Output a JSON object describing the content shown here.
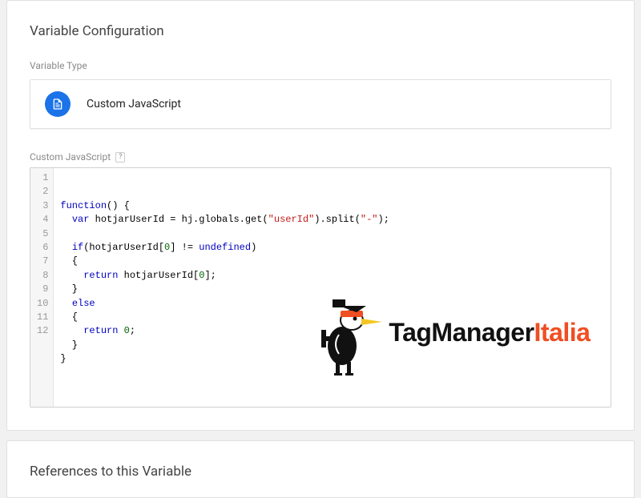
{
  "sections": {
    "config_title": "Variable Configuration",
    "type_label": "Variable Type",
    "variable_type_name": "Custom JavaScript",
    "code_label": "Custom JavaScript",
    "help_symbol": "?",
    "references_title": "References to this Variable"
  },
  "code": {
    "line_count": 12,
    "lines": [
      {
        "n": 1,
        "tokens": [
          {
            "t": "function",
            "c": "blue"
          },
          {
            "t": "() {",
            "c": "black"
          }
        ]
      },
      {
        "n": 2,
        "tokens": [
          {
            "t": "  ",
            "c": "black"
          },
          {
            "t": "var",
            "c": "blue"
          },
          {
            "t": " hotjarUserId = hj.globals.get(",
            "c": "black"
          },
          {
            "t": "\"userId\"",
            "c": "red"
          },
          {
            "t": ").split(",
            "c": "black"
          },
          {
            "t": "\"-\"",
            "c": "red"
          },
          {
            "t": ");",
            "c": "black"
          }
        ]
      },
      {
        "n": 3,
        "tokens": []
      },
      {
        "n": 4,
        "tokens": [
          {
            "t": "  ",
            "c": "black"
          },
          {
            "t": "if",
            "c": "blue"
          },
          {
            "t": "(hotjarUserId[",
            "c": "black"
          },
          {
            "t": "0",
            "c": "num"
          },
          {
            "t": "] != ",
            "c": "black"
          },
          {
            "t": "undefined",
            "c": "blue"
          },
          {
            "t": ")",
            "c": "black"
          }
        ]
      },
      {
        "n": 5,
        "tokens": [
          {
            "t": "  {",
            "c": "black"
          }
        ]
      },
      {
        "n": 6,
        "tokens": [
          {
            "t": "    ",
            "c": "black"
          },
          {
            "t": "return",
            "c": "blue"
          },
          {
            "t": " hotjarUserId[",
            "c": "black"
          },
          {
            "t": "0",
            "c": "num"
          },
          {
            "t": "];",
            "c": "black"
          }
        ]
      },
      {
        "n": 7,
        "tokens": [
          {
            "t": "  }",
            "c": "black"
          }
        ]
      },
      {
        "n": 8,
        "tokens": [
          {
            "t": "  ",
            "c": "black"
          },
          {
            "t": "else",
            "c": "blue"
          }
        ]
      },
      {
        "n": 9,
        "tokens": [
          {
            "t": "  {",
            "c": "black"
          }
        ]
      },
      {
        "n": 10,
        "tokens": [
          {
            "t": "    ",
            "c": "black"
          },
          {
            "t": "return",
            "c": "blue"
          },
          {
            "t": " ",
            "c": "black"
          },
          {
            "t": "0",
            "c": "num"
          },
          {
            "t": ";",
            "c": "black"
          }
        ]
      },
      {
        "n": 11,
        "tokens": [
          {
            "t": "  }",
            "c": "black"
          }
        ]
      },
      {
        "n": 12,
        "tokens": [
          {
            "t": "}",
            "c": "black"
          }
        ]
      }
    ]
  },
  "logo": {
    "text_main": "TagManager",
    "text_accent": "Italia",
    "accent_color": "#f04e23"
  }
}
